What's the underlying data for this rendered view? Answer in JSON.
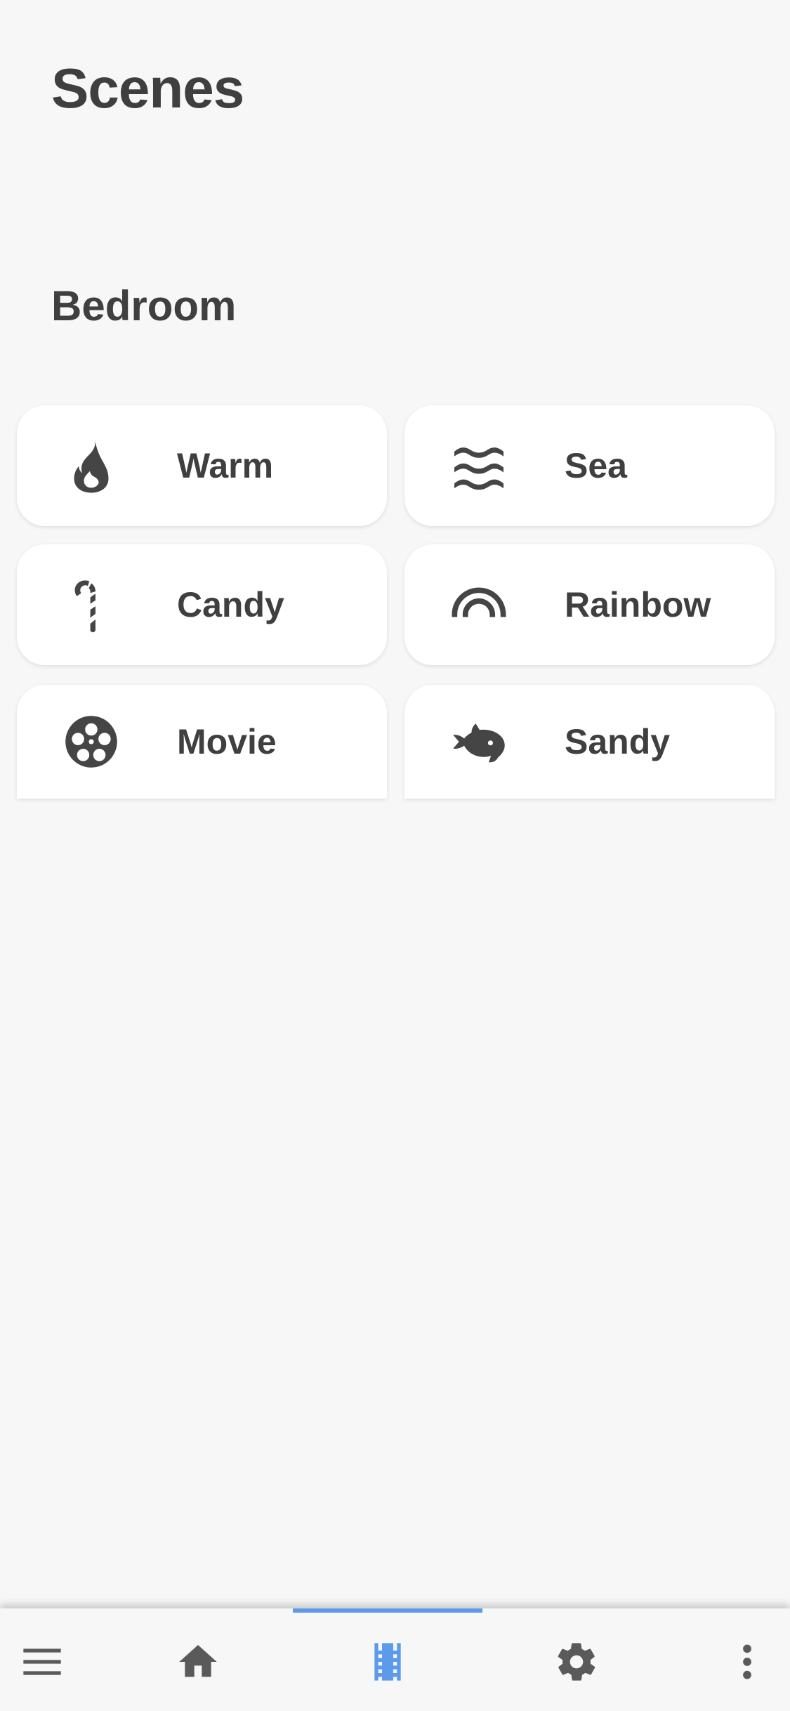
{
  "page": {
    "title": "Scenes"
  },
  "section": {
    "title": "Bedroom"
  },
  "scenes": [
    {
      "label": "Warm",
      "icon": "fire-icon"
    },
    {
      "label": "Sea",
      "icon": "waves-icon"
    },
    {
      "label": "Candy",
      "icon": "candy-cane-icon"
    },
    {
      "label": "Rainbow",
      "icon": "rainbow-icon"
    },
    {
      "label": "Movie",
      "icon": "film-reel-icon"
    },
    {
      "label": "Sandy",
      "icon": "fish-icon"
    }
  ],
  "bottom_nav": {
    "items": [
      {
        "icon": "menu-icon"
      },
      {
        "icon": "home-icon"
      },
      {
        "icon": "film-strip-icon",
        "active": true
      },
      {
        "icon": "gear-icon"
      },
      {
        "icon": "more-vertical-icon"
      }
    ],
    "accent_color": "#5b9bea"
  }
}
